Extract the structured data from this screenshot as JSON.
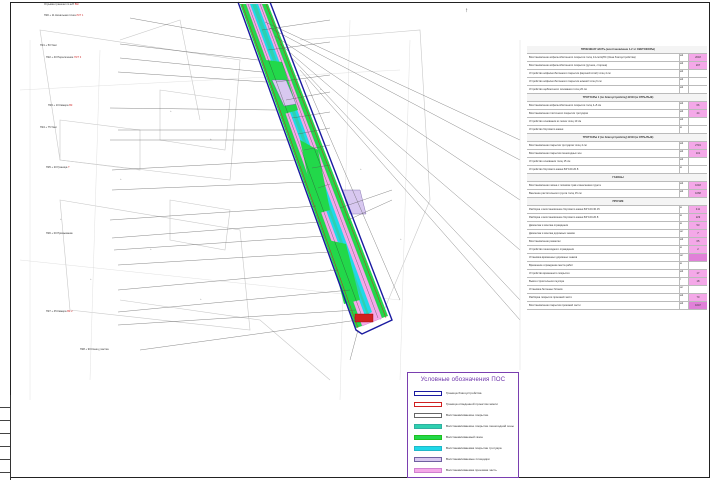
{
  "legend": {
    "title": "Условные обозначения ПОС",
    "items": [
      {
        "label": "Граница благоустройства",
        "color": "#1a1aa0",
        "fill": "#ffffff"
      },
      {
        "label": "Граница отведенной проектом земли",
        "color": "#d02020",
        "fill": "#ffffff"
      },
      {
        "label": "Восстанавливаемое покрытие",
        "color": "#666666",
        "fill": "#ffffff"
      },
      {
        "label": "Восстанавливаемое покрытие пешеходной зоны",
        "color": "#30b0a0",
        "fill": "#2fd0b0"
      },
      {
        "label": "Восстанавливаемый газон",
        "color": "#20c020",
        "fill": "#22d84a"
      },
      {
        "label": "Восстанавливаемая покрытие тротуара",
        "color": "#20b8c8",
        "fill": "#20d8e8"
      },
      {
        "label": "Восстанавливаемые площадки",
        "color": "#7060a0",
        "fill": "#d8c8f0"
      },
      {
        "label": "Восстанавливаемая проезжая часть",
        "color": "#d080d0",
        "fill": "#f4a8e8"
      }
    ]
  },
  "table": {
    "sections": [
      {
        "title": "ПРОЕЗЖАЯ ЧАСТЬ (восстановление 1-2 эт СВЕТОФОРЫ)",
        "rows": [
          {
            "text": "Восстановление асфальтобетонного покрытия толщ 14-см ЩПС (Зона благоустройства)",
            "unit": "м2",
            "value": "2018",
            "hl": "mag"
          },
          {
            "text": "Восстановление асфальтобетонного покрытия (ручное, сторона)",
            "unit": "м2",
            "value": "207",
            "hl": "mag"
          },
          {
            "text": "Устройство асфальтобетонного покрытия (верхний слой) толщ 4 см",
            "unit": "м2",
            "value": "",
            "hl": ""
          },
          {
            "text": "Устройство асфальтобетонного покрытия нижний толщ 6 см",
            "unit": "м2",
            "value": "",
            "hl": ""
          },
          {
            "text": "Устройство щебёночного основания толщ 20 см",
            "unit": "м2",
            "value": "",
            "hl": ""
          }
        ]
      },
      {
        "title": "ТРОТУАРЫ 1 (по благоустройству) ВЧ13 (ж ОТРЫТЫЕ)",
        "rows": [
          {
            "text": "Восстановление асфальтобетонного покрытия толщ 4+5 см",
            "unit": "м2",
            "value": "66",
            "hl": "mag"
          },
          {
            "text": "Восстановление плиточного покрытия тротуаров",
            "unit": "м2",
            "value": "44",
            "hl": "mag"
          },
          {
            "text": "Устройство основания из песка толщ 10 см",
            "unit": "м2",
            "value": "",
            "hl": ""
          },
          {
            "text": "Устройство бортового камня",
            "unit": "м",
            "value": "",
            "hl": ""
          }
        ]
      },
      {
        "title": "ТРОТУАРЫ 2 (по благоустройству) ВЧ13 (ж ОТРЫТЫЕ)",
        "rows": [
          {
            "text": "Восстановление покрытия тротуаров толщ 4 см",
            "unit": "м2",
            "value": "2719",
            "hl": "mag"
          },
          {
            "text": "Восстановление покрытия пешеходных зон",
            "unit": "м2",
            "value": "101",
            "hl": "mag"
          },
          {
            "text": "Устройство основания толщ 15 см",
            "unit": "м2",
            "value": "",
            "hl": ""
          },
          {
            "text": "Устройство бортового камня БР 100.20.8",
            "unit": "м",
            "value": "",
            "hl": ""
          }
        ]
      },
      {
        "title": "ГАЗОНЫ",
        "rows": [
          {
            "text": "Восстановление газона с посевом трав и внесением грунта",
            "unit": "м2",
            "value": "1018",
            "hl": "mag"
          },
          {
            "text": "Внесение растительного грунта толщ 15 см",
            "unit": "м2",
            "value": "1068",
            "hl": "mag"
          }
        ]
      },
      {
        "title": "ПРОЧИЕ",
        "rows": [
          {
            "text": "Разборка и восстановление бортового камня БР 100.30.15",
            "unit": "м",
            "value": "411",
            "hl": "mag"
          },
          {
            "text": "Разборка и восстановление бортового камня БР 100.20.8",
            "unit": "м",
            "value": "229",
            "hl": "mag"
          },
          {
            "text": "Демонтаж и монтаж ограждения",
            "unit": "м",
            "value": "53",
            "hl": "mag"
          },
          {
            "text": "Демонтаж и монтаж дорожных знаков",
            "unit": "шт",
            "value": "7",
            "hl": "mag"
          },
          {
            "text": "Восстановление разметки",
            "unit": "м2",
            "value": "65",
            "hl": "mag"
          },
          {
            "text": "Устройство пешеходного ограждения",
            "unit": "м",
            "value": "2",
            "hl": "mag"
          },
          {
            "text": "Установка временных дорожных знаков",
            "unit": "шт",
            "value": "",
            "hl": "mag2"
          },
          {
            "text": "Временное ограждение места работ",
            "unit": "м",
            "value": "",
            "hl": ""
          },
          {
            "text": "Устройство временного покрытия",
            "unit": "м2",
            "value": "17",
            "hl": "mag"
          },
          {
            "text": "Вывоз строительного мусора",
            "unit": "т",
            "value": "18",
            "hl": "mag"
          },
          {
            "text": "Установка бетонных блоков",
            "unit": "шт",
            "value": "",
            "hl": ""
          },
          {
            "text": "Разборка покрытия проезжей части",
            "unit": "м2",
            "value": "70",
            "hl": "mag"
          },
          {
            "text": "Восстановление покрытия проезжей части",
            "unit": "м2",
            "value": "1047",
            "hl": "mag2"
          }
        ]
      }
    ]
  },
  "callouts": [
    {
      "text": "Отрывка траншеи по ж/б",
      "red": "ВЖ"
    },
    {
      "text": "ПК0 + 11 Начальная точка",
      "red": "ЛКТ 1"
    },
    {
      "text": "ПК1 + 50 Узел",
      "red": ""
    },
    {
      "text": "ПК2 + 40 Пересечение",
      "red": "ПКТ 3"
    },
    {
      "text": "ПК3 + 10 Камера",
      "red": "ВК"
    },
    {
      "text": "ПК4 + 75 Узел",
      "red": ""
    },
    {
      "text": "ПК5 + 20 Граница",
      "red": "Т"
    },
    {
      "text": "ПК6 + 00 Примыкание",
      "red": ""
    },
    {
      "text": "ПК7 + 45 Камера",
      "red": "ВК 2"
    },
    {
      "text": "ПК8 + 90 Конец участка",
      "red": ""
    }
  ]
}
